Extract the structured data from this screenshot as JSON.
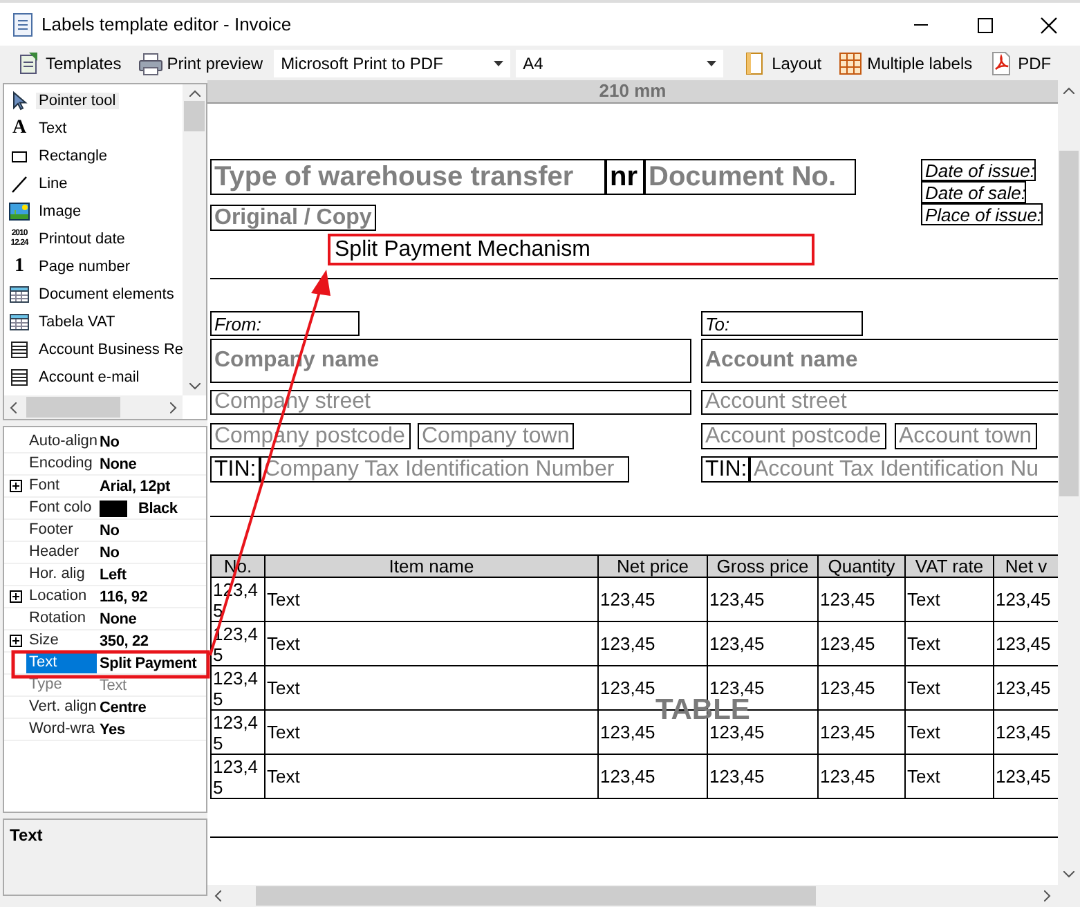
{
  "window": {
    "title": "Labels template editor - Invoice"
  },
  "toolbar": [
    {
      "kind": "button",
      "label": "Templates"
    },
    {
      "kind": "button",
      "label": "Print preview"
    },
    {
      "kind": "dropdown",
      "value": "Microsoft Print to PDF"
    },
    {
      "kind": "dropdown",
      "value": "A4"
    },
    {
      "kind": "button",
      "label": "Layout"
    },
    {
      "kind": "button",
      "label": "Multiple labels"
    },
    {
      "kind": "button",
      "label": "PDF"
    }
  ],
  "toolbox": [
    {
      "label": "Pointer tool",
      "selected": true
    },
    {
      "label": "Text",
      "glyph": "A",
      "selected": false
    },
    {
      "label": "Rectangle",
      "selected": false
    },
    {
      "label": "Line",
      "selected": false
    },
    {
      "label": "Image",
      "selected": false
    },
    {
      "label": "Printout date",
      "glyph": "2010 12.24",
      "selected": false
    },
    {
      "label": "Page number",
      "glyph": "1",
      "selected": false
    },
    {
      "label": "Document elements",
      "selected": false
    },
    {
      "label": "Tabela VAT",
      "selected": false
    },
    {
      "label": "Account Business Re",
      "selected": false
    },
    {
      "label": "Account e-mail",
      "selected": false
    }
  ],
  "properties": [
    {
      "name": "Auto-align",
      "value": "No",
      "expandable": false,
      "selected": false,
      "disabled": false
    },
    {
      "name": "Encoding",
      "value": "None",
      "expandable": false,
      "selected": false,
      "disabled": false
    },
    {
      "name": "Font",
      "value": "Arial, 12pt",
      "expandable": true,
      "selected": false,
      "disabled": false
    },
    {
      "name": "Font colo",
      "value": "Black",
      "color": "#000000",
      "expandable": false,
      "selected": false,
      "disabled": false
    },
    {
      "name": "Footer",
      "value": "No",
      "expandable": false,
      "selected": false,
      "disabled": false
    },
    {
      "name": "Header",
      "value": "No",
      "expandable": false,
      "selected": false,
      "disabled": false
    },
    {
      "name": "Hor. alig",
      "value": "Left",
      "expandable": false,
      "selected": false,
      "disabled": false
    },
    {
      "name": "Location",
      "value": "116, 92",
      "expandable": true,
      "selected": false,
      "disabled": false
    },
    {
      "name": "Rotation",
      "value": "None",
      "expandable": false,
      "selected": false,
      "disabled": false
    },
    {
      "name": "Size",
      "value": "350, 22",
      "expandable": true,
      "selected": false,
      "disabled": false
    },
    {
      "name": "Text",
      "value": "Split Payment",
      "expandable": false,
      "selected": true,
      "disabled": false
    },
    {
      "name": "Type",
      "value": "Text",
      "expandable": false,
      "selected": false,
      "disabled": true
    },
    {
      "name": "Vert. align",
      "value": "Centre",
      "expandable": false,
      "selected": false,
      "disabled": false
    },
    {
      "name": "Word-wra",
      "value": "Yes",
      "expandable": false,
      "selected": false,
      "disabled": false
    }
  ],
  "description": {
    "title": "Text"
  },
  "canvas": {
    "ruler": "210 mm",
    "elements": [
      {
        "kind": "title",
        "text": "Type of warehouse transfer",
        "selected": false
      },
      {
        "kind": "title-dark",
        "text": "nr",
        "selected": false
      },
      {
        "kind": "title",
        "text": "Document No.",
        "selected": false
      },
      {
        "kind": "caption",
        "text": "Date of issue:",
        "selected": false
      },
      {
        "kind": "caption",
        "text": "Date of sale:",
        "selected": false
      },
      {
        "kind": "caption",
        "text": "Place of issue:",
        "selected": false
      },
      {
        "kind": "subtitle",
        "text": "Original / Copy",
        "selected": false
      },
      {
        "kind": "plain",
        "text": "Split Payment Mechanism",
        "selected": true
      },
      {
        "kind": "caption",
        "text": "From:",
        "selected": false
      },
      {
        "kind": "caption",
        "text": "To:",
        "selected": false
      },
      {
        "kind": "heading",
        "text": "Company name",
        "selected": false
      },
      {
        "kind": "heading",
        "text": "Account name",
        "selected": false
      },
      {
        "kind": "value",
        "text": "Company street",
        "selected": false
      },
      {
        "kind": "value",
        "text": "Account street",
        "selected": false
      },
      {
        "kind": "value",
        "text": "Company postcode",
        "selected": false
      },
      {
        "kind": "value",
        "text": "Company town",
        "selected": false
      },
      {
        "kind": "value",
        "text": "Account postcode",
        "selected": false
      },
      {
        "kind": "value",
        "text": "Account town",
        "selected": false
      },
      {
        "kind": "plain",
        "text": "TIN:",
        "selected": false
      },
      {
        "kind": "value",
        "text": "Company Tax Identification Number",
        "selected": false
      },
      {
        "kind": "plain",
        "text": "TIN:",
        "selected": false
      },
      {
        "kind": "value",
        "text": "Account Tax Identification Nu",
        "selected": false
      }
    ],
    "table": {
      "label": "TABLE",
      "columns": [
        "No.",
        "Item name",
        "Net price",
        "Gross price",
        "Quantity",
        "VAT rate",
        "Net v"
      ],
      "rows": [
        [
          "123,45",
          "Text",
          "123,45",
          "123,45",
          "123,45",
          "Text",
          "123,45"
        ],
        [
          "123,45",
          "Text",
          "123,45",
          "123,45",
          "123,45",
          "Text",
          "123,45"
        ],
        [
          "123,45",
          "Text",
          "123,45",
          "123,45",
          "123,45",
          "Text",
          "123,45"
        ],
        [
          "123,45",
          "Text",
          "123,45",
          "123,45",
          "123,45",
          "Text",
          "123,45"
        ],
        [
          "123,45",
          "Text",
          "123,45",
          "123,45",
          "123,45",
          "Text",
          "123,45"
        ]
      ]
    }
  }
}
